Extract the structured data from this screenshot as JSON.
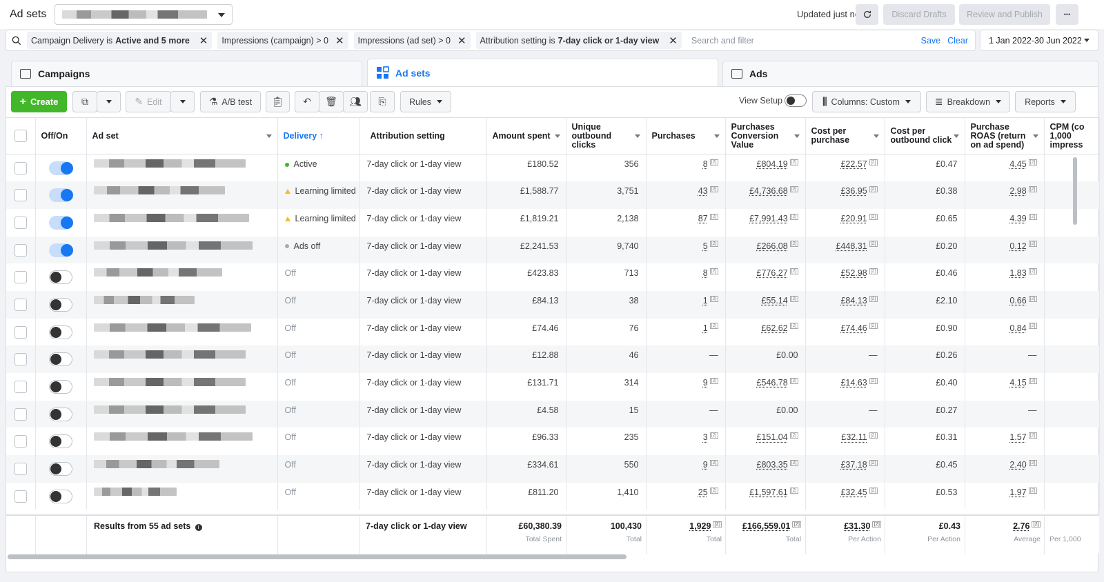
{
  "header": {
    "title": "Ad sets",
    "updated": "Updated just now",
    "discard": "Discard Drafts",
    "review": "Review and Publish",
    "more": "•••"
  },
  "filters": {
    "chips": [
      {
        "pre": "Campaign Delivery is",
        "bold": "Active and 5 more",
        "post": ""
      },
      {
        "pre": "Impressions (campaign) > 0",
        "bold": "",
        "post": ""
      },
      {
        "pre": "Impressions (ad set) > 0",
        "bold": "",
        "post": ""
      },
      {
        "pre": "Attribution setting is",
        "bold": "7-day click or 1-day view",
        "post": ""
      }
    ],
    "placeholder": "Search and filter",
    "save": "Save",
    "clear": "Clear",
    "date_range": "1 Jan 2022-30 Jun 2022"
  },
  "tabs": {
    "campaigns": "Campaigns",
    "adsets": "Ad sets",
    "ads": "Ads"
  },
  "toolbar": {
    "create": "Create",
    "edit": "Edit",
    "ab_test": "A/B test",
    "rules": "Rules",
    "view_setup": "View Setup",
    "columns": "Columns: Custom",
    "breakdown": "Breakdown",
    "reports": "Reports"
  },
  "table": {
    "headers": {
      "onoff": "Off/On",
      "adset": "Ad set",
      "delivery": "Delivery ↑",
      "attribution": "Attribution setting",
      "spent": "Amount spent",
      "clicks": "Unique outbound clicks",
      "purchases": "Purchases",
      "conv_value": "Purchases Conversion Value",
      "cpp": "Cost per purchase",
      "cpoc": "Cost per outbound click",
      "roas": "Purchase ROAS (return on ad spend)",
      "cpm": "CPM (co 1,000 impress"
    },
    "rows": [
      {
        "on": true,
        "delivery": "Active",
        "status": "active",
        "attr": "7-day click or 1-day view",
        "spent": "£180.52",
        "clicks": "356",
        "purchases": "8",
        "value": "£804.19",
        "cpp": "£22.57",
        "cpoc": "£0.47",
        "roas": "4.45"
      },
      {
        "on": true,
        "delivery": "Learning limited",
        "status": "learning",
        "attr": "7-day click or 1-day view",
        "spent": "£1,588.77",
        "clicks": "3,751",
        "purchases": "43",
        "value": "£4,736.68",
        "cpp": "£36.95",
        "cpoc": "£0.38",
        "roas": "2.98"
      },
      {
        "on": true,
        "delivery": "Learning limited",
        "status": "learning",
        "attr": "7-day click or 1-day view",
        "spent": "£1,819.21",
        "clicks": "2,138",
        "purchases": "87",
        "value": "£7,991.43",
        "cpp": "£20.91",
        "cpoc": "£0.65",
        "roas": "4.39"
      },
      {
        "on": true,
        "delivery": "Ads off",
        "status": "adsoff",
        "attr": "7-day click or 1-day view",
        "spent": "£2,241.53",
        "clicks": "9,740",
        "purchases": "5",
        "value": "£266.08",
        "cpp": "£448.31",
        "cpoc": "£0.20",
        "roas": "0.12"
      },
      {
        "on": false,
        "delivery": "Off",
        "status": "off",
        "attr": "7-day click or 1-day view",
        "spent": "£423.83",
        "clicks": "713",
        "purchases": "8",
        "value": "£776.27",
        "cpp": "£52.98",
        "cpoc": "£0.46",
        "roas": "1.83"
      },
      {
        "on": false,
        "delivery": "Off",
        "status": "off",
        "attr": "7-day click or 1-day view",
        "spent": "£84.13",
        "clicks": "38",
        "purchases": "1",
        "value": "£55.14",
        "cpp": "£84.13",
        "cpoc": "£2.10",
        "roas": "0.66"
      },
      {
        "on": false,
        "delivery": "Off",
        "status": "off",
        "attr": "7-day click or 1-day view",
        "spent": "£74.46",
        "clicks": "76",
        "purchases": "1",
        "value": "£62.62",
        "cpp": "£74.46",
        "cpoc": "£0.90",
        "roas": "0.84"
      },
      {
        "on": false,
        "delivery": "Off",
        "status": "off",
        "attr": "7-day click or 1-day view",
        "spent": "£12.88",
        "clicks": "46",
        "purchases": "—",
        "value": "£0.00",
        "cpp": "—",
        "cpoc": "£0.26",
        "roas": "—"
      },
      {
        "on": false,
        "delivery": "Off",
        "status": "off",
        "attr": "7-day click or 1-day view",
        "spent": "£131.71",
        "clicks": "314",
        "purchases": "9",
        "value": "£546.78",
        "cpp": "£14.63",
        "cpoc": "£0.40",
        "roas": "4.15"
      },
      {
        "on": false,
        "delivery": "Off",
        "status": "off",
        "attr": "7-day click or 1-day view",
        "spent": "£4.58",
        "clicks": "15",
        "purchases": "—",
        "value": "£0.00",
        "cpp": "—",
        "cpoc": "£0.27",
        "roas": "—"
      },
      {
        "on": false,
        "delivery": "Off",
        "status": "off",
        "attr": "7-day click or 1-day view",
        "spent": "£96.33",
        "clicks": "235",
        "purchases": "3",
        "value": "£151.04",
        "cpp": "£32.11",
        "cpoc": "£0.31",
        "roas": "1.57"
      },
      {
        "on": false,
        "delivery": "Off",
        "status": "off",
        "attr": "7-day click or 1-day view",
        "spent": "£334.61",
        "clicks": "550",
        "purchases": "9",
        "value": "£803.35",
        "cpp": "£37.18",
        "cpoc": "£0.45",
        "roas": "2.40"
      },
      {
        "on": false,
        "delivery": "Off",
        "status": "off",
        "attr": "7-day click or 1-day view",
        "spent": "£811.20",
        "clicks": "1,410",
        "purchases": "25",
        "value": "£1,597.61",
        "cpp": "£32.45",
        "cpoc": "£0.53",
        "roas": "1.97"
      }
    ],
    "footer": {
      "results": "Results from 55 ad sets",
      "attr": "7-day click or 1-day view",
      "spent": "£60,380.39",
      "spent_sub": "Total Spent",
      "clicks": "100,430",
      "clicks_sub": "Total",
      "purchases": "1,929",
      "purchases_sub": "Total",
      "value": "£166,559.01",
      "value_sub": "Total",
      "cpp": "£31.30",
      "cpp_sub": "Per Action",
      "cpoc": "£0.43",
      "cpoc_sub": "Per Action",
      "roas": "2.76",
      "roas_sub": "Average",
      "cpm_sub": "Per 1,000"
    },
    "sup": "[2]"
  }
}
